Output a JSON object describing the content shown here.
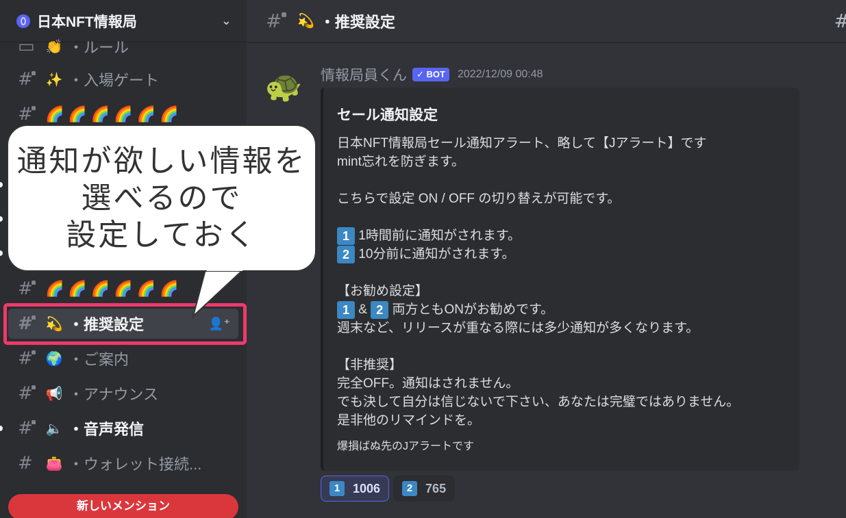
{
  "server": {
    "name": "日本NFT情報局"
  },
  "channels": [
    {
      "emoji": "👏",
      "label": "・ルール"
    },
    {
      "emoji": "✨",
      "label": "・入場ゲート"
    },
    {
      "rainbow": "🌈🌈🌈🌈🌈🌈"
    },
    {
      "rainbow": "🌈🌈🌈🌈🌈🌈"
    },
    {
      "emoji": "💫",
      "label": "・推奨設定"
    },
    {
      "emoji": "🌍",
      "label": "・ご案内"
    },
    {
      "emoji": "📢",
      "label": "・アナウンス"
    },
    {
      "emoji": "🔈",
      "label": "・音声発信"
    },
    {
      "emoji": "👛",
      "label": "・ウォレット接続..."
    }
  ],
  "mention_pill": "新しいメンション",
  "callout": {
    "text": "通知が欲しい情報を\n選べるので\n設定しておく"
  },
  "topbar": {
    "emoji": "💫",
    "title": "・推奨設定"
  },
  "message": {
    "avatar_emoji": "🐢",
    "author": "情報局員くん",
    "bot_tag": "✓ BOT",
    "timestamp": "2022/12/09 00:48",
    "embed": {
      "title": "セール通知設定",
      "intro": "日本NFT情報局セール通知アラート、略して【Jアラート】です\nmint忘れを防ぎます。",
      "toggle": "こちらで設定 ON / OFF の切り替えが可能です。",
      "opt1": "1時間前に通知がされます。",
      "opt2": "10分前に通知がされます。",
      "rec_heading": "【お勧め設定】",
      "rec_amp": "&",
      "rec_line": "両方ともONがお勧めです。",
      "rec_note": "週末など、リリースが重なる際には多少通知が多くなります。",
      "nonrec_heading": "【非推奨】",
      "nonrec_body": "完全OFF。通知はされません。\nでも決して自分は信じないで下さい、あなたは完璧ではありません。\n是非他のリマインドを。",
      "footer": "爆損ばぬ先のJアラートです",
      "key1": "1",
      "key2": "2"
    }
  },
  "reactions": [
    {
      "key": "1",
      "count": "1006",
      "me": true
    },
    {
      "key": "2",
      "count": "765",
      "me": false
    }
  ],
  "colors": {
    "accent": "#5865f2",
    "highlight": "#f0396b",
    "mention": "#da373c",
    "keycap": "#3b88c3"
  }
}
